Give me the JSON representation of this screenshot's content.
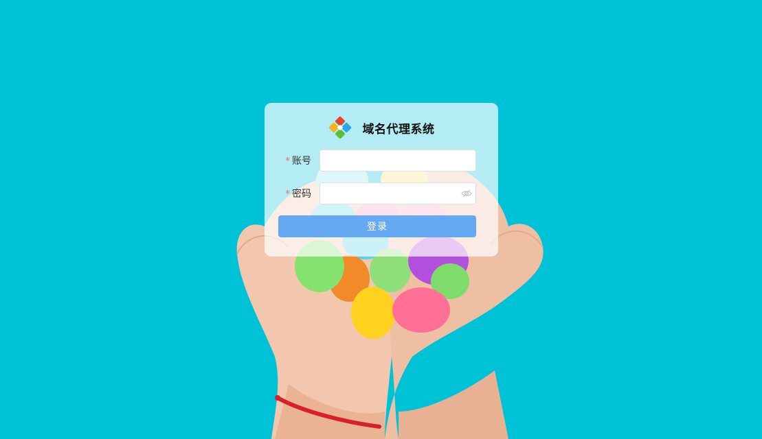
{
  "app": {
    "title": "域名代理系统",
    "logo_icon": "colorful-diamond-logo-icon"
  },
  "form": {
    "account": {
      "label": "账号",
      "required_mark": "*",
      "value": "",
      "placeholder": ""
    },
    "password": {
      "label": "密码",
      "required_mark": "*",
      "value": "",
      "placeholder": "",
      "toggle_icon": "eye-hidden-icon"
    },
    "submit_label": "登录"
  },
  "colors": {
    "page_background": "#00c2d6",
    "button": "#66a9f3",
    "required": "#f56c6c"
  }
}
